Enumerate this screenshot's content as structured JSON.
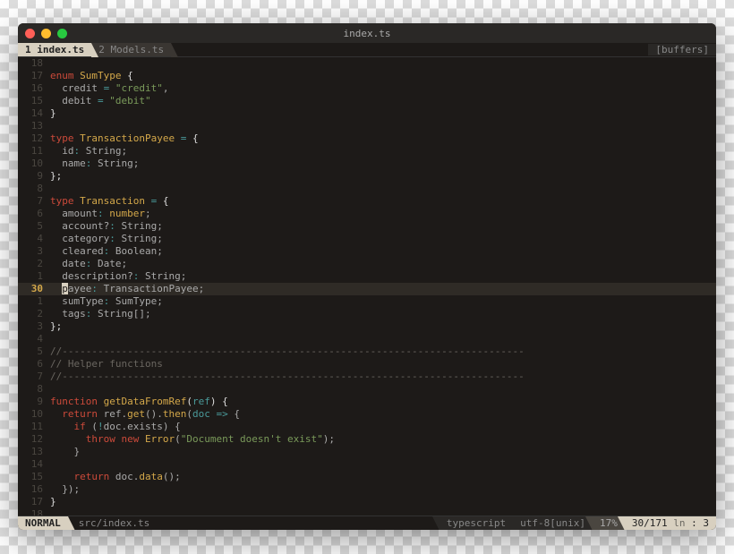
{
  "window": {
    "title": "index.ts"
  },
  "tabs": [
    {
      "num": "1",
      "label": "index.ts",
      "active": true
    },
    {
      "num": "2",
      "label": "Models.ts",
      "active": false
    }
  ],
  "buffers_label": "[buffers]",
  "lines": [
    {
      "n": "18",
      "tokens": []
    },
    {
      "n": "17",
      "tokens": [
        {
          "c": "kw-red",
          "t": "enum"
        },
        {
          "c": "kw-white",
          "t": " "
        },
        {
          "c": "kw-yellow",
          "t": "SumType"
        },
        {
          "c": "kw-white",
          "t": " {"
        }
      ]
    },
    {
      "n": "16",
      "tokens": [
        {
          "c": "code",
          "t": "  credit "
        },
        {
          "c": "kw-cyan",
          "t": "="
        },
        {
          "c": "code",
          "t": " "
        },
        {
          "c": "kw-green",
          "t": "\"credit\""
        },
        {
          "c": "code",
          "t": ","
        }
      ]
    },
    {
      "n": "15",
      "tokens": [
        {
          "c": "code",
          "t": "  debit "
        },
        {
          "c": "kw-cyan",
          "t": "="
        },
        {
          "c": "code",
          "t": " "
        },
        {
          "c": "kw-green",
          "t": "\"debit\""
        }
      ]
    },
    {
      "n": "14",
      "tokens": [
        {
          "c": "kw-white",
          "t": "}"
        }
      ]
    },
    {
      "n": "13",
      "tokens": []
    },
    {
      "n": "12",
      "tokens": [
        {
          "c": "kw-red",
          "t": "type"
        },
        {
          "c": "kw-white",
          "t": " "
        },
        {
          "c": "kw-yellow",
          "t": "TransactionPayee"
        },
        {
          "c": "kw-white",
          "t": " "
        },
        {
          "c": "kw-cyan",
          "t": "="
        },
        {
          "c": "kw-white",
          "t": " {"
        }
      ]
    },
    {
      "n": "11",
      "tokens": [
        {
          "c": "code",
          "t": "  id"
        },
        {
          "c": "kw-cyan",
          "t": ":"
        },
        {
          "c": "code",
          "t": " String;"
        }
      ]
    },
    {
      "n": "10",
      "tokens": [
        {
          "c": "code",
          "t": "  name"
        },
        {
          "c": "kw-cyan",
          "t": ":"
        },
        {
          "c": "code",
          "t": " String;"
        }
      ]
    },
    {
      "n": "9",
      "tokens": [
        {
          "c": "kw-white",
          "t": "};"
        }
      ]
    },
    {
      "n": "8",
      "tokens": []
    },
    {
      "n": "7",
      "tokens": [
        {
          "c": "kw-red",
          "t": "type"
        },
        {
          "c": "kw-white",
          "t": " "
        },
        {
          "c": "kw-yellow",
          "t": "Transaction"
        },
        {
          "c": "kw-white",
          "t": " "
        },
        {
          "c": "kw-cyan",
          "t": "="
        },
        {
          "c": "kw-white",
          "t": " {"
        }
      ]
    },
    {
      "n": "6",
      "tokens": [
        {
          "c": "code",
          "t": "  amount"
        },
        {
          "c": "kw-cyan",
          "t": ":"
        },
        {
          "c": "code",
          "t": " "
        },
        {
          "c": "kw-yellow",
          "t": "number"
        },
        {
          "c": "code",
          "t": ";"
        }
      ]
    },
    {
      "n": "5",
      "tokens": [
        {
          "c": "code",
          "t": "  account?"
        },
        {
          "c": "kw-cyan",
          "t": ":"
        },
        {
          "c": "code",
          "t": " String;"
        }
      ]
    },
    {
      "n": "4",
      "tokens": [
        {
          "c": "code",
          "t": "  category"
        },
        {
          "c": "kw-cyan",
          "t": ":"
        },
        {
          "c": "code",
          "t": " String;"
        }
      ]
    },
    {
      "n": "3",
      "tokens": [
        {
          "c": "code",
          "t": "  cleared"
        },
        {
          "c": "kw-cyan",
          "t": ":"
        },
        {
          "c": "code",
          "t": " Boolean;"
        }
      ]
    },
    {
      "n": "2",
      "tokens": [
        {
          "c": "code",
          "t": "  date"
        },
        {
          "c": "kw-cyan",
          "t": ":"
        },
        {
          "c": "code",
          "t": " Date;"
        }
      ]
    },
    {
      "n": "1",
      "tokens": [
        {
          "c": "code",
          "t": "  description?"
        },
        {
          "c": "kw-cyan",
          "t": ":"
        },
        {
          "c": "code",
          "t": " String;"
        }
      ]
    },
    {
      "n": "30",
      "current": true,
      "tokens": [
        {
          "c": "code",
          "t": "  "
        },
        {
          "c": "cursor",
          "t": "p"
        },
        {
          "c": "code",
          "t": "ayee"
        },
        {
          "c": "kw-cyan",
          "t": ":"
        },
        {
          "c": "code",
          "t": " TransactionPayee;"
        }
      ]
    },
    {
      "n": "1",
      "tokens": [
        {
          "c": "code",
          "t": "  sumType"
        },
        {
          "c": "kw-cyan",
          "t": ":"
        },
        {
          "c": "code",
          "t": " SumType;"
        }
      ]
    },
    {
      "n": "2",
      "tokens": [
        {
          "c": "code",
          "t": "  tags"
        },
        {
          "c": "kw-cyan",
          "t": ":"
        },
        {
          "c": "code",
          "t": " String[];"
        }
      ]
    },
    {
      "n": "3",
      "tokens": [
        {
          "c": "kw-white",
          "t": "};"
        }
      ]
    },
    {
      "n": "4",
      "tokens": []
    },
    {
      "n": "5",
      "tokens": [
        {
          "c": "kw-comment",
          "t": "//------------------------------------------------------------------------------"
        }
      ]
    },
    {
      "n": "6",
      "tokens": [
        {
          "c": "kw-comment",
          "t": "// Helper functions"
        }
      ]
    },
    {
      "n": "7",
      "tokens": [
        {
          "c": "kw-comment",
          "t": "//------------------------------------------------------------------------------"
        }
      ]
    },
    {
      "n": "8",
      "tokens": []
    },
    {
      "n": "9",
      "tokens": [
        {
          "c": "kw-red",
          "t": "function"
        },
        {
          "c": "kw-white",
          "t": " "
        },
        {
          "c": "kw-yellow",
          "t": "getDataFromRef"
        },
        {
          "c": "kw-white",
          "t": "("
        },
        {
          "c": "kw-cyan",
          "t": "ref"
        },
        {
          "c": "kw-white",
          "t": ") {"
        }
      ]
    },
    {
      "n": "10",
      "tokens": [
        {
          "c": "code",
          "t": "  "
        },
        {
          "c": "kw-red",
          "t": "return"
        },
        {
          "c": "code",
          "t": " ref."
        },
        {
          "c": "kw-yellow",
          "t": "get"
        },
        {
          "c": "code",
          "t": "()."
        },
        {
          "c": "kw-yellow",
          "t": "then"
        },
        {
          "c": "code",
          "t": "("
        },
        {
          "c": "kw-cyan",
          "t": "doc"
        },
        {
          "c": "code",
          "t": " "
        },
        {
          "c": "kw-cyan",
          "t": "=>"
        },
        {
          "c": "code",
          "t": " {"
        }
      ]
    },
    {
      "n": "11",
      "tokens": [
        {
          "c": "code",
          "t": "    "
        },
        {
          "c": "kw-red",
          "t": "if"
        },
        {
          "c": "code",
          "t": " ("
        },
        {
          "c": "kw-cyan",
          "t": "!"
        },
        {
          "c": "code",
          "t": "doc.exists) {"
        }
      ]
    },
    {
      "n": "12",
      "tokens": [
        {
          "c": "code",
          "t": "      "
        },
        {
          "c": "kw-red",
          "t": "throw"
        },
        {
          "c": "code",
          "t": " "
        },
        {
          "c": "kw-red",
          "t": "new"
        },
        {
          "c": "code",
          "t": " "
        },
        {
          "c": "kw-yellow",
          "t": "Error"
        },
        {
          "c": "code",
          "t": "("
        },
        {
          "c": "kw-green",
          "t": "\"Document doesn't exist\""
        },
        {
          "c": "code",
          "t": ");"
        }
      ]
    },
    {
      "n": "13",
      "tokens": [
        {
          "c": "code",
          "t": "    }"
        }
      ]
    },
    {
      "n": "14",
      "tokens": []
    },
    {
      "n": "15",
      "tokens": [
        {
          "c": "code",
          "t": "    "
        },
        {
          "c": "kw-red",
          "t": "return"
        },
        {
          "c": "code",
          "t": " doc."
        },
        {
          "c": "kw-yellow",
          "t": "data"
        },
        {
          "c": "code",
          "t": "();"
        }
      ]
    },
    {
      "n": "16",
      "tokens": [
        {
          "c": "code",
          "t": "  });"
        }
      ]
    },
    {
      "n": "17",
      "tokens": [
        {
          "c": "kw-white",
          "t": "}"
        }
      ]
    },
    {
      "n": "18",
      "tokens": []
    }
  ],
  "status": {
    "mode": "NORMAL",
    "filepath": "src/index.ts",
    "filetype": "typescript",
    "encoding": "utf-8[unix]",
    "percent": "17%",
    "position": "30/171",
    "col": ": 3"
  }
}
